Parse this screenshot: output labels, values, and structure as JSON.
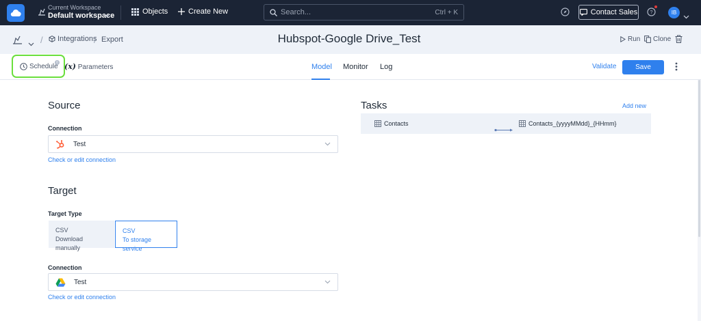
{
  "topnav": {
    "workspace_caption": "Current Workspace",
    "workspace_name": "Default workspace",
    "objects_label": "Objects",
    "create_label": "Create New",
    "search_placeholder": "Search...",
    "search_shortcut": "Ctrl + K",
    "contact_sales_label": "Contact Sales",
    "avatar_initials": "IB"
  },
  "breadcrumb": {
    "integrations_label": "Integrations",
    "export_label": "Export"
  },
  "page": {
    "title": "Hubspot-Google Drive_Test",
    "run_label": "Run",
    "clone_label": "Clone"
  },
  "toolbar": {
    "schedule_label": "Schedule",
    "schedule_badge": "0",
    "params_icon": "(x)",
    "params_label": "Parameters",
    "tabs": [
      "Model",
      "Monitor",
      "Log"
    ],
    "validate_label": "Validate",
    "save_label": "Save"
  },
  "source": {
    "title": "Source",
    "connection_label": "Connection",
    "connection_value": "Test",
    "check_link": "Check or edit connection"
  },
  "target": {
    "title": "Target",
    "type_label": "Target Type",
    "types": [
      {
        "name": "CSV",
        "desc": "Download manually"
      },
      {
        "name": "CSV",
        "desc": "To storage service"
      }
    ],
    "connection_label": "Connection",
    "connection_value": "Test",
    "check_link": "Check or edit connection"
  },
  "tasks": {
    "title": "Tasks",
    "add_label": "Add new",
    "rows": [
      {
        "source": "Contacts",
        "target": "Contacts_{yyyyMMdd}_{HHmm}"
      }
    ]
  },
  "colors": {
    "accent": "#2f80ed",
    "nav_bg": "#1b2435",
    "highlight": "#6adf3c"
  },
  "icons": [
    "cloud-logo-icon",
    "workspace-icon",
    "grid-icon",
    "plus-icon",
    "search-icon",
    "compass-icon",
    "chat-icon",
    "help-icon",
    "package-icon",
    "cube-icon",
    "play-icon",
    "copy-icon",
    "trash-icon",
    "clock-icon",
    "kebab-icon",
    "hubspot-icon",
    "google-drive-icon",
    "table-icon",
    "arrow-right-icon"
  ]
}
